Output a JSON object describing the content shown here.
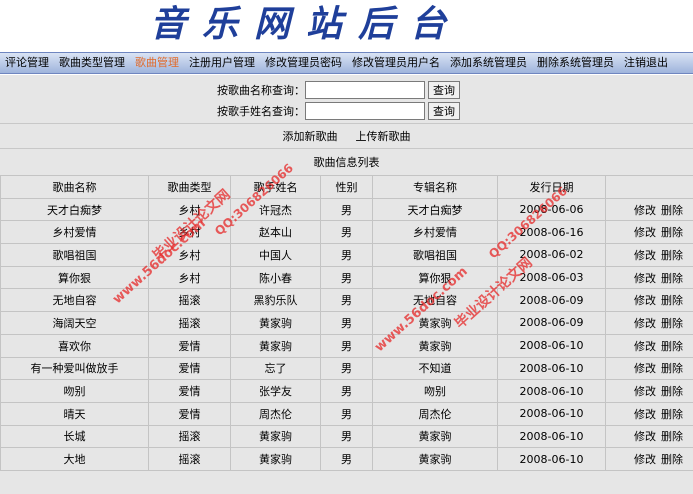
{
  "header": {
    "title": "音乐网站后台"
  },
  "nav": {
    "items": [
      "评论管理",
      "歌曲类型管理",
      "歌曲管理",
      "注册用户管理",
      "修改管理员密码",
      "修改管理员用户名",
      "添加系统管理员",
      "删除系统管理员",
      "注销退出"
    ],
    "active_index": 2
  },
  "search": {
    "by_song_label": "按歌曲名称查询：",
    "by_singer_label": "按歌手姓名查询：",
    "button_label": "查询",
    "song_value": "",
    "singer_value": ""
  },
  "actions": {
    "add_song": "添加新歌曲",
    "upload_song": "上传新歌曲"
  },
  "list_title": "歌曲信息列表",
  "table": {
    "columns": [
      "歌曲名称",
      "歌曲类型",
      "歌手姓名",
      "性别",
      "专辑名称",
      "发行日期",
      ""
    ],
    "edit_label": "修改",
    "delete_label": "删除",
    "rows": [
      [
        "天才白痴梦",
        "乡村",
        "许冠杰",
        "男",
        "天才白痴梦",
        "2008-06-06"
      ],
      [
        "乡村爱情",
        "乡村",
        "赵本山",
        "男",
        "乡村爱情",
        "2008-06-16"
      ],
      [
        "歌唱祖国",
        "乡村",
        "中国人",
        "男",
        "歌唱祖国",
        "2008-06-02"
      ],
      [
        "算你狠",
        "乡村",
        "陈小春",
        "男",
        "算你狠",
        "2008-06-03"
      ],
      [
        "无地自容",
        "摇滚",
        "黑豹乐队",
        "男",
        "无地自容",
        "2008-06-09"
      ],
      [
        "海阔天空",
        "摇滚",
        "黄家驹",
        "男",
        "黄家驹",
        "2008-06-09"
      ],
      [
        "喜欢你",
        "爱情",
        "黄家驹",
        "男",
        "黄家驹",
        "2008-06-10"
      ],
      [
        "有一种爱叫做放手",
        "爱情",
        "忘了",
        "男",
        "不知道",
        "2008-06-10"
      ],
      [
        "吻别",
        "爱情",
        "张学友",
        "男",
        "吻别",
        "2008-06-10"
      ],
      [
        "晴天",
        "爱情",
        "周杰伦",
        "男",
        "周杰伦",
        "2008-06-10"
      ],
      [
        "长城",
        "摇滚",
        "黄家驹",
        "男",
        "黄家驹",
        "2008-06-10"
      ],
      [
        "大地",
        "摇滚",
        "黄家驹",
        "男",
        "黄家驹",
        "2008-06-10"
      ]
    ]
  },
  "watermarks": [
    "毕业设计论文网",
    "www.56doc.com",
    "QQ:306826066"
  ],
  "colors": {
    "title": "#1f3f9a",
    "nav_active": "#e06a2a",
    "watermark": "#e62828"
  }
}
